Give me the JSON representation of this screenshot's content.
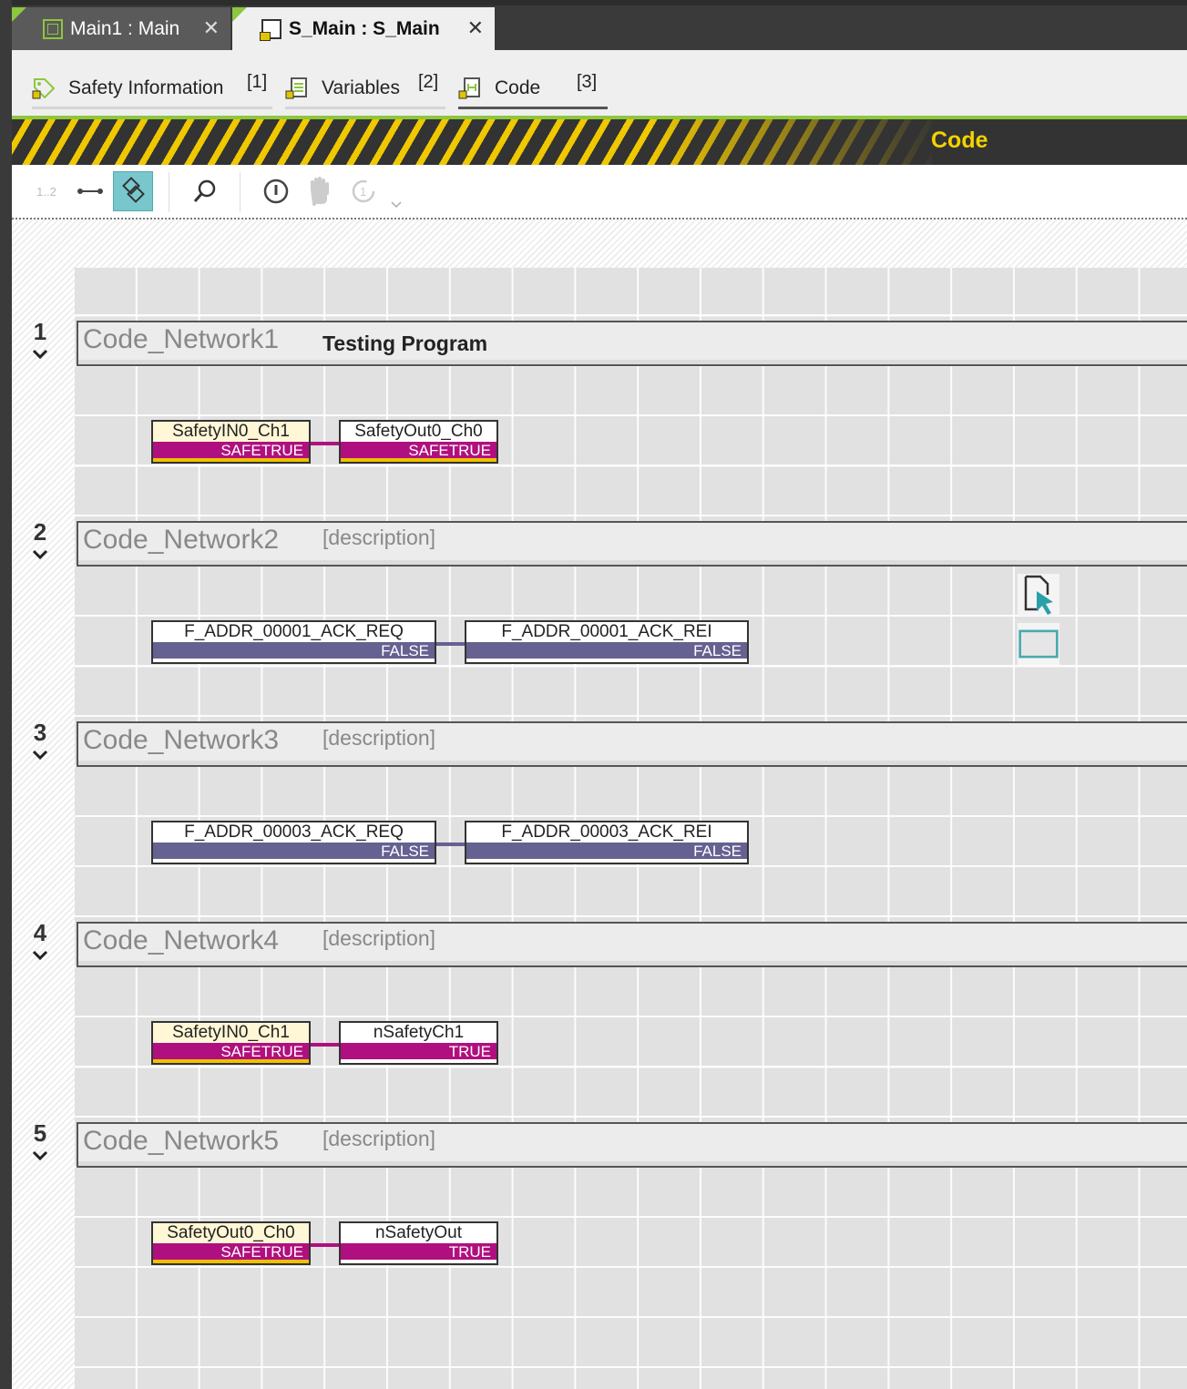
{
  "doc_tabs": [
    {
      "label": "Main1 : Main",
      "close": "✕"
    },
    {
      "label": "S_Main : S_Main",
      "close": "✕"
    }
  ],
  "sub_tabs": [
    {
      "label": "Safety Information",
      "count": "[1]"
    },
    {
      "label": "Variables",
      "count": "[2]"
    },
    {
      "label": "Code",
      "count": "[3]"
    }
  ],
  "section_title": "Code",
  "toolbar": {
    "line_numbers": "1..2"
  },
  "colors": {
    "accent_green": "#8dc63f",
    "safe_magenta": "#b0107f",
    "bool_purple": "#656191",
    "hazard_yellow": "#f0c800"
  },
  "networks": [
    {
      "num": "1",
      "name": "Code_Network1",
      "desc": "Testing Program",
      "left": {
        "name": "SafetyIN0_Ch1",
        "value": "SAFETRUE"
      },
      "right": {
        "name": "SafetyOut0_Ch0",
        "value": "SAFETRUE"
      }
    },
    {
      "num": "2",
      "name": "Code_Network2",
      "desc": "[description]",
      "left": {
        "name": "F_ADDR_00001_ACK_REQ",
        "value": "FALSE"
      },
      "right": {
        "name": "F_ADDR_00001_ACK_REI",
        "value": "FALSE"
      }
    },
    {
      "num": "3",
      "name": "Code_Network3",
      "desc": "[description]",
      "left": {
        "name": "F_ADDR_00003_ACK_REQ",
        "value": "FALSE"
      },
      "right": {
        "name": "F_ADDR_00003_ACK_REI",
        "value": "FALSE"
      }
    },
    {
      "num": "4",
      "name": "Code_Network4",
      "desc": "[description]",
      "left": {
        "name": "SafetyIN0_Ch1",
        "value": "SAFETRUE"
      },
      "right": {
        "name": "nSafetyCh1",
        "value": "TRUE"
      }
    },
    {
      "num": "5",
      "name": "Code_Network5",
      "desc": "[description]",
      "left": {
        "name": "SafetyOut0_Ch0",
        "value": "SAFETRUE"
      },
      "right": {
        "name": "nSafetyOut",
        "value": "TRUE"
      }
    }
  ]
}
